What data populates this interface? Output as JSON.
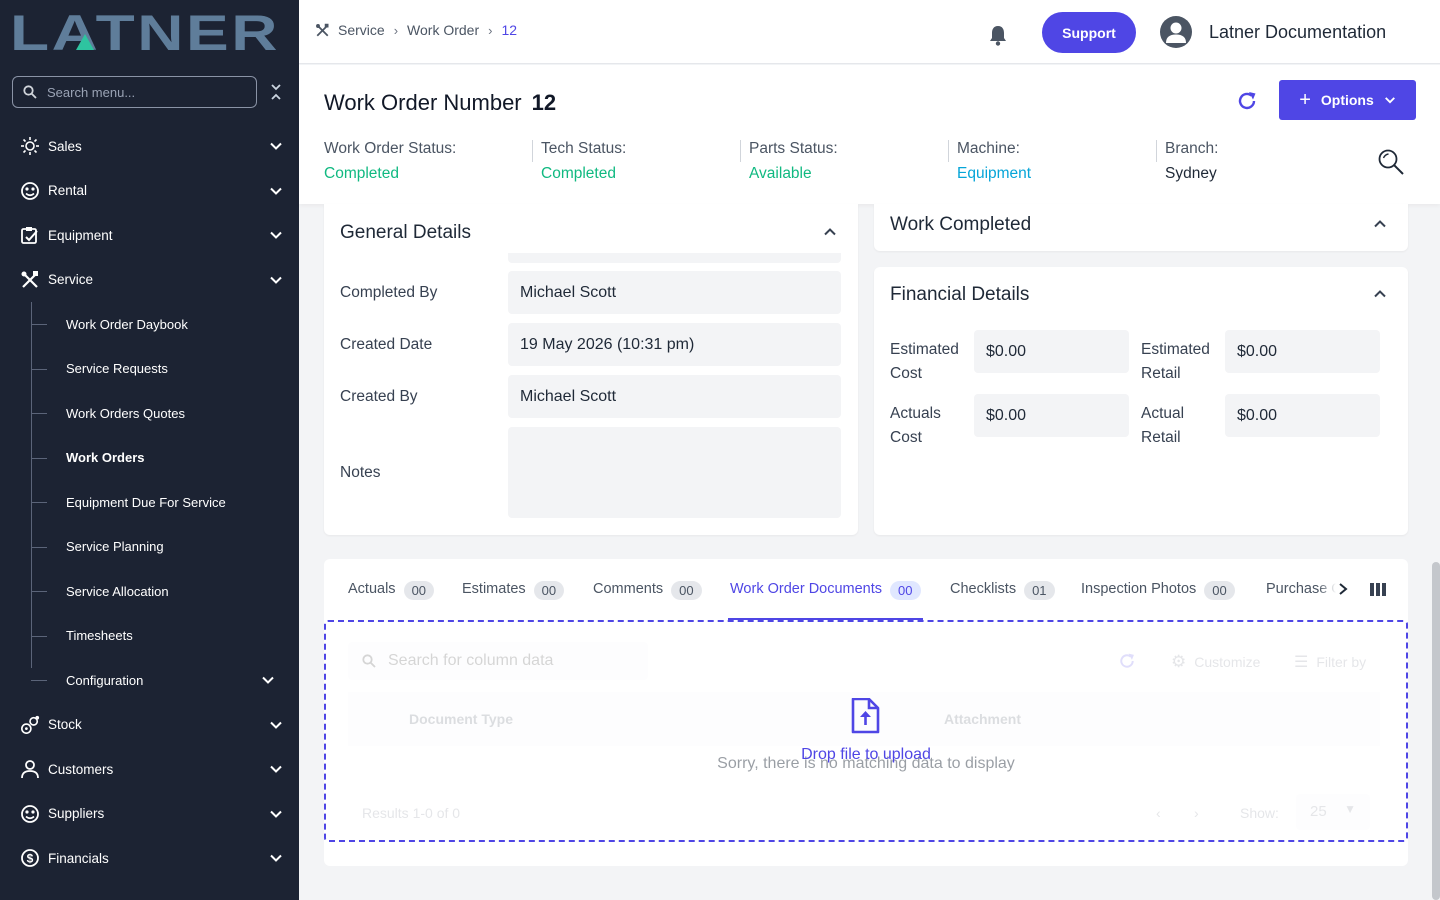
{
  "brand": {
    "logo_text": "LATNER",
    "accent": "#4f46e5",
    "sidebar_bg": "#1c2333",
    "success": "#10b981",
    "info": "#06a5d8"
  },
  "sidebar": {
    "search_placeholder": "Search menu...",
    "items": [
      {
        "label": "Sales",
        "icon": "sales-icon"
      },
      {
        "label": "Rental",
        "icon": "rental-icon"
      },
      {
        "label": "Equipment",
        "icon": "equipment-icon"
      },
      {
        "label": "Service",
        "icon": "service-icon"
      }
    ],
    "service_sub": [
      {
        "label": "Work Order Daybook"
      },
      {
        "label": "Service Requests"
      },
      {
        "label": "Work Orders Quotes"
      },
      {
        "label": "Work Orders",
        "active": true
      },
      {
        "label": "Equipment Due For Service"
      },
      {
        "label": "Service Planning"
      },
      {
        "label": "Service Allocation"
      },
      {
        "label": "Timesheets"
      },
      {
        "label": "Configuration"
      }
    ],
    "items_after": [
      {
        "label": "Stock",
        "icon": "stock-icon"
      },
      {
        "label": "Customers",
        "icon": "customers-icon"
      },
      {
        "label": "Suppliers",
        "icon": "suppliers-icon"
      },
      {
        "label": "Financials",
        "icon": "financials-icon"
      }
    ]
  },
  "topbar": {
    "breadcrumb": [
      "Service",
      "Work Order",
      "12"
    ],
    "support_label": "Support",
    "user_name": "Latner Documentation"
  },
  "header": {
    "title": "Work Order Number",
    "number": "12",
    "options_label": "Options",
    "statuses": [
      {
        "label": "Work Order Status:",
        "value": "Completed"
      },
      {
        "label": "Tech Status:",
        "value": "Completed"
      },
      {
        "label": "Parts Status:",
        "value": "Available"
      },
      {
        "label": "Machine:",
        "value": "Equipment"
      },
      {
        "label": "Branch:",
        "value": "Sydney"
      }
    ]
  },
  "general": {
    "title": "General Details",
    "completed_by_label": "Completed By",
    "completed_by": "Michael Scott",
    "created_date_label": "Created Date",
    "created_date": "19 May 2026 (10:31 pm)",
    "created_by_label": "Created By",
    "created_by": "Michael Scott",
    "notes_label": "Notes",
    "notes": ""
  },
  "work_completed": {
    "title": "Work Completed"
  },
  "financial": {
    "title": "Financial Details",
    "est_cost_label_1": "Estimated",
    "est_cost_label_2": "Cost",
    "est_cost": "$0.00",
    "est_retail_label_1": "Estimated",
    "est_retail_label_2": "Retail",
    "est_retail": "$0.00",
    "act_cost_label_1": "Actuals",
    "act_cost_label_2": "Cost",
    "act_cost": "$0.00",
    "act_retail_label_1": "Actual",
    "act_retail_label_2": "Retail",
    "act_retail": "$0.00"
  },
  "tabs": [
    {
      "label": "Actuals",
      "count": "00"
    },
    {
      "label": "Estimates",
      "count": "00"
    },
    {
      "label": "Comments",
      "count": "00"
    },
    {
      "label": "Work Order Documents",
      "count": "00",
      "active": true
    },
    {
      "label": "Checklists",
      "count": "01"
    },
    {
      "label": "Inspection Photos",
      "count": "00"
    },
    {
      "label": "Purchase O"
    }
  ],
  "table": {
    "search_placeholder": "Search for column data",
    "customize_label": "Customize",
    "filter_label": "Filter by",
    "columns": [
      "Document Type",
      "Attachment"
    ],
    "empty_message": "Sorry, there is no matching data to display",
    "results_label": "Results 1-0 of 0",
    "show_label": "Show:",
    "page_size": "25",
    "drop_label": "Drop file to upload"
  }
}
